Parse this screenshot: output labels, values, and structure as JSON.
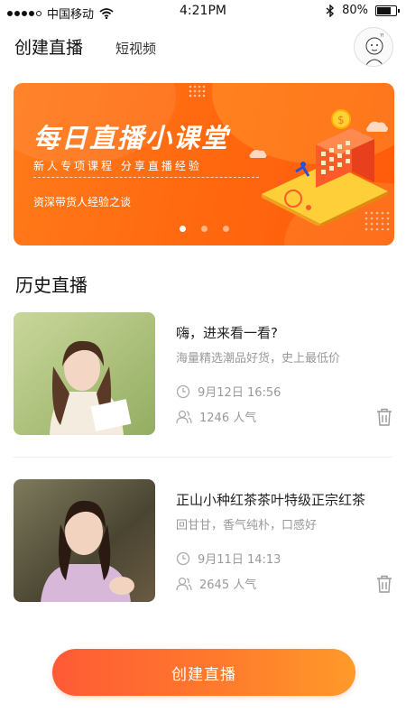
{
  "status_bar": {
    "carrier": "中国移动",
    "time": "4:21PM",
    "battery": "80%",
    "battery_level": 0.8,
    "signal_dots_on": 4,
    "signal_dots_total": 5
  },
  "header": {
    "tab_active": "创建直播",
    "tab_inactive": "短视频"
  },
  "banner": {
    "title": "每日直播小课堂",
    "subtitle": "新人专项课程  分享直播经验",
    "tag": "资深带货人经验之谈",
    "page_count": 3,
    "active_page": 0
  },
  "section": {
    "title": "历史直播"
  },
  "live_list": [
    {
      "title": "嗨，进来看一看?",
      "desc": "海量精选潮品好货，史上最低价",
      "time": "9月12日 16:56",
      "popularity": "1246 人气"
    },
    {
      "title": "正山小种红茶茶叶特级正宗红茶",
      "desc": "回甘甘，香气纯朴，口感好",
      "time": "9月11日 14:13",
      "popularity": "2645 人气"
    }
  ],
  "create_button": {
    "label": "创建直播"
  },
  "colors": {
    "accent": "#ff6a10",
    "button_start": "#ff5a36",
    "button_end": "#ff9a2a",
    "muted_text": "#999999"
  }
}
